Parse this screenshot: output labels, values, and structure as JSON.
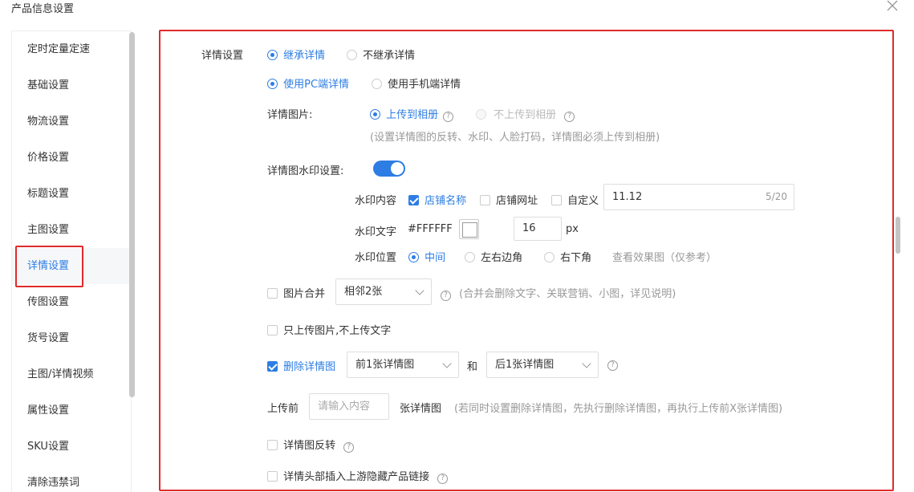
{
  "dialog": {
    "title": "产品信息设置"
  },
  "sidebar": {
    "items": [
      {
        "label": "定时定量定速"
      },
      {
        "label": "基础设置"
      },
      {
        "label": "物流设置"
      },
      {
        "label": "价格设置"
      },
      {
        "label": "标题设置"
      },
      {
        "label": "主图设置"
      },
      {
        "label": "详情设置"
      },
      {
        "label": "传图设置"
      },
      {
        "label": "货号设置"
      },
      {
        "label": "主图/详情视频"
      },
      {
        "label": "属性设置"
      },
      {
        "label": "SKU设置"
      },
      {
        "label": "清除违禁词"
      }
    ],
    "active_index": 6
  },
  "detail": {
    "section_label": "详情设置",
    "inherit": {
      "on_label": "继承详情",
      "off_label": "不继承详情"
    },
    "source": {
      "pc_label": "使用PC端详情",
      "mobile_label": "使用手机端详情"
    },
    "image": {
      "label": "详情图片:",
      "upload_label": "上传到相册",
      "no_upload_label": "不上传到相册",
      "hint": "(设置详情图的反转、水印、人脸打码，详情图必须上传到相册)"
    },
    "watermark": {
      "label": "详情图水印设置:",
      "enabled": true,
      "content_label": "水印内容",
      "store_name": "店铺名称",
      "store_url": "店铺网址",
      "custom": "自定义",
      "custom_value": "11.12",
      "custom_count": "5/20",
      "text_label": "水印文字",
      "color_value": "#FFFFFF",
      "size_value": "16",
      "size_unit": "px",
      "position_label": "水印位置",
      "pos_center": "中间",
      "pos_lr": "左右边角",
      "pos_br": "右下角",
      "preview_link": "查看效果图（仅参考）"
    },
    "merge": {
      "label": "图片合并",
      "select_value": "相邻2张",
      "hint": "(合并会删除文字、关联营销、小图，详见说明)"
    },
    "only_images": {
      "label": "只上传图片,不上传文字"
    },
    "delete": {
      "label": "删除详情图",
      "front_value": "前1张详情图",
      "and_label": "和",
      "back_value": "后1张详情图"
    },
    "before_upload": {
      "prefix": "上传前",
      "placeholder": "请输入内容",
      "suffix": "张详情图",
      "hint": "(若同时设置删除详情图，先执行删除详情图，再执行上传前X张详情图)"
    },
    "flip": {
      "label": "详情图反转"
    },
    "insert_link": {
      "label": "详情头部插入上游隐藏产品链接"
    }
  },
  "colors": {
    "accent": "#2d7de4",
    "highlight": "#e02b2b"
  }
}
